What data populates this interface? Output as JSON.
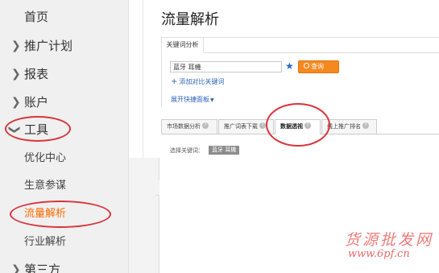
{
  "sidebar": {
    "items": [
      {
        "label": "首页"
      },
      {
        "label": "推广计划",
        "chevron": "chevron-right-icon"
      },
      {
        "label": "报表",
        "chevron": "chevron-right-icon"
      },
      {
        "label": "账户",
        "chevron": "chevron-right-icon"
      },
      {
        "label": "工具",
        "chevron": "chevron-down-icon",
        "expanded": true
      },
      {
        "label": "优化中心"
      },
      {
        "label": "生意参谋"
      },
      {
        "label": "流量解析",
        "active": true
      },
      {
        "label": "行业解析"
      },
      {
        "label": "第三方",
        "chevron": "chevron-right-icon"
      }
    ]
  },
  "main": {
    "title": "流量解析",
    "keyword_tab": "关键词分析",
    "keyword_value": "蓝牙 耳機",
    "query_button": "查询",
    "add_compare": "添加对比关键词",
    "expand_board": "展开快捷面板",
    "tabs": [
      {
        "label": "市场数据分析"
      },
      {
        "label": "推广词表下载"
      },
      {
        "label": "数据透视",
        "active": true
      },
      {
        "label": "线上推广排名"
      }
    ],
    "select_keyword_label": "选择关键词：",
    "selected_keyword": "蓝牙 耳機"
  },
  "annotations": {
    "highlight_color": "#d9343c"
  },
  "watermark": {
    "title": "货源批发网",
    "url": "www.6pf.cn"
  },
  "colors": {
    "accent": "#ff6a00",
    "button": "#f5891f",
    "link": "#2d63b8",
    "star": "#2f69c3"
  }
}
